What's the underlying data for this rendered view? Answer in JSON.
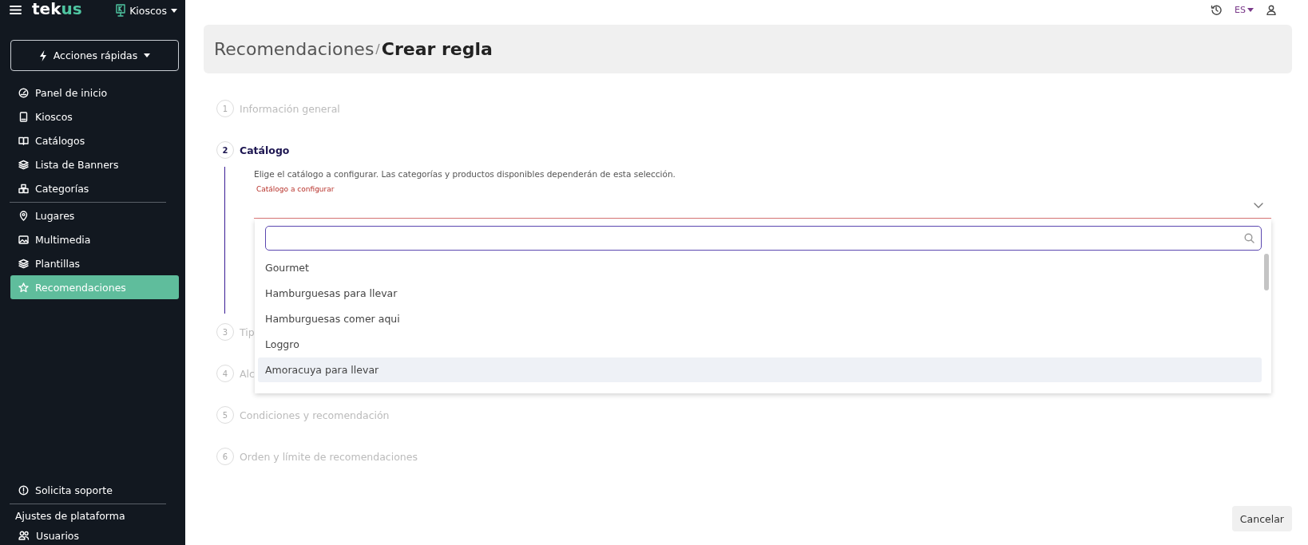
{
  "sidebar": {
    "logo": [
      "tek",
      "us"
    ],
    "workspace": "Kioscos",
    "quick_actions": "Acciones rápidas",
    "nav_groups": [
      [
        {
          "label": "Panel de inicio",
          "selected": false
        },
        {
          "label": "Kioscos",
          "selected": false
        },
        {
          "label": "Catálogos",
          "selected": false
        },
        {
          "label": "Lista de Banners",
          "selected": false
        },
        {
          "label": "Categorías",
          "selected": false
        }
      ],
      [
        {
          "label": "Lugares",
          "selected": false
        },
        {
          "label": "Multimedia",
          "selected": false
        },
        {
          "label": "Plantillas",
          "selected": false
        },
        {
          "label": "Recomendaciones",
          "selected": true
        }
      ]
    ],
    "support": "Solicita soporte",
    "settings_heading": "Ajustes de plataforma",
    "settings_items": [
      {
        "label": "Usuarios"
      }
    ]
  },
  "topbar": {
    "language": "ES"
  },
  "header": {
    "breadcrumb": "Recomendaciones",
    "separator": "/",
    "title": "Crear regla"
  },
  "steps": [
    {
      "number": "1",
      "label": "Información general",
      "active": false
    },
    {
      "number": "2",
      "label": "Catálogo",
      "active": true
    },
    {
      "number": "3",
      "label": "Tip",
      "active": false
    },
    {
      "number": "4",
      "label": "Alc",
      "active": false
    },
    {
      "number": "5",
      "label": "Condiciones y recomendación",
      "active": false
    },
    {
      "number": "6",
      "label": "Orden y límite de recomendaciones",
      "active": false
    }
  ],
  "catalog": {
    "description": "Elige el catálogo a configurar. Las categorías y productos disponibles dependerán de esta selección.",
    "field_label": "Catálogo a configurar",
    "options": [
      {
        "label": "Gourmet",
        "highlighted": false
      },
      {
        "label": "Hamburguesas para llevar",
        "highlighted": false
      },
      {
        "label": "Hamburguesas comer aqui",
        "highlighted": false
      },
      {
        "label": "Loggro",
        "highlighted": false
      },
      {
        "label": "Amoracuya para llevar",
        "highlighted": true
      }
    ]
  },
  "buttons": {
    "cancel": "Cancelar"
  }
}
